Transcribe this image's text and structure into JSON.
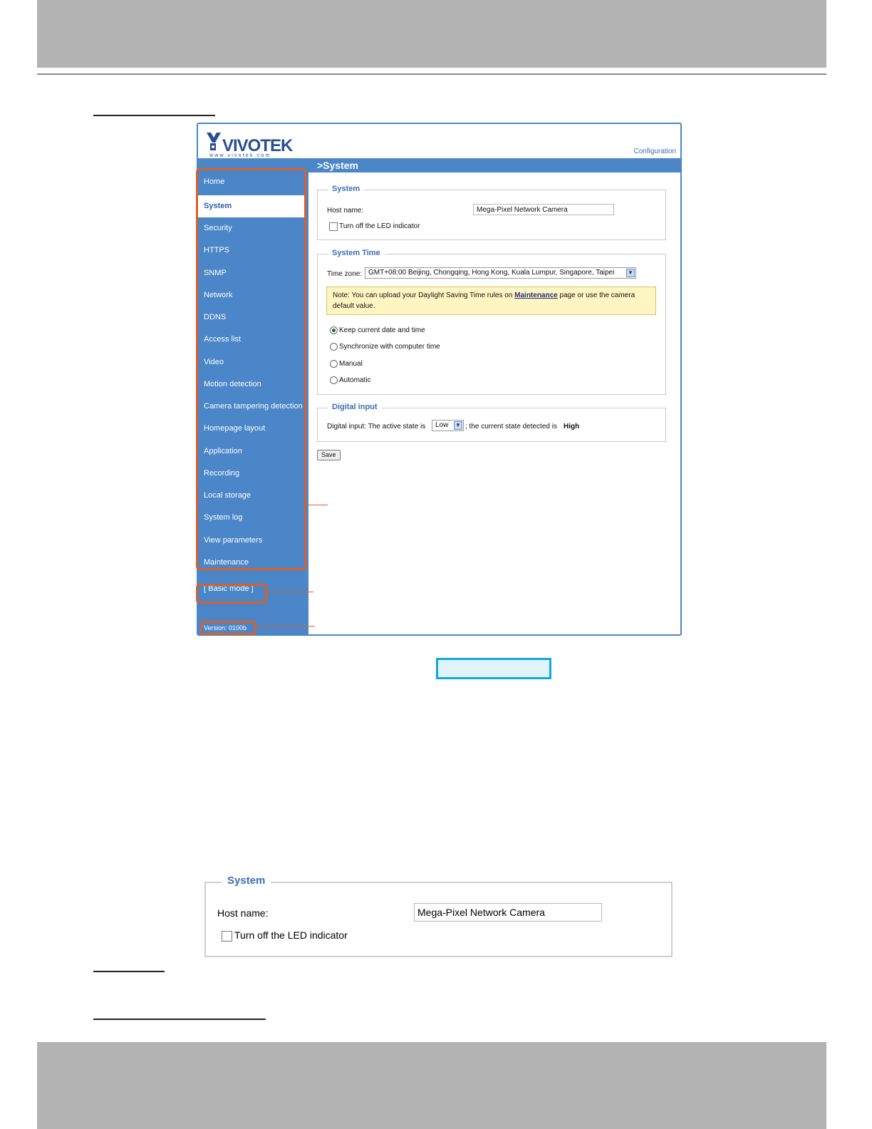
{
  "app": {
    "config_link": "Configuration",
    "page_title": ">System",
    "logo_text": "VIVOTEK",
    "logo_url_text": "www.vivotek.com"
  },
  "sidebar": {
    "items": [
      {
        "label": "Home"
      },
      {
        "label": "System"
      },
      {
        "label": "Security"
      },
      {
        "label": "HTTPS"
      },
      {
        "label": "SNMP"
      },
      {
        "label": "Network"
      },
      {
        "label": "DDNS"
      },
      {
        "label": "Access list"
      },
      {
        "label": "Video"
      },
      {
        "label": "Motion detection"
      },
      {
        "label": "Camera tampering detection"
      },
      {
        "label": "Homepage layout"
      },
      {
        "label": "Application"
      },
      {
        "label": "Recording"
      },
      {
        "label": "Local storage"
      },
      {
        "label": "System log"
      },
      {
        "label": "View parameters"
      },
      {
        "label": "Maintenance"
      }
    ],
    "active_item": "System",
    "mode_link": "[ Basic mode ]",
    "version": "Version: 0100b"
  },
  "system_section": {
    "legend": "System",
    "host_label": "Host name:",
    "host_value": "Mega-Pixel Network Camera",
    "led_label": "Turn off the LED indicator",
    "led_checked": false
  },
  "time_section": {
    "legend": "System Time",
    "tz_label": "Time zone:",
    "tz_value": "GMT+08:00 Beijing, Chongqing, Hong Kong, Kuala Lumpur, Singapore, Taipei",
    "note_before": "Note: You can upload your Daylight Saving Time rules on ",
    "note_link": "Maintenance",
    "note_after": " page or use the camera default value.",
    "options": [
      {
        "label": "Keep current date and time",
        "selected": true
      },
      {
        "label": "Synchronize with computer time",
        "selected": false
      },
      {
        "label": "Manual",
        "selected": false
      },
      {
        "label": "Automatic",
        "selected": false
      }
    ]
  },
  "digital_section": {
    "legend": "Digital input",
    "text_before": "Digital input: The active state is",
    "state_value": "Low",
    "text_after": "; the current state detected is",
    "detected_value": "High"
  },
  "save_label": "Save",
  "colors": {
    "sidebar": "#4a86c8",
    "highlight": "#d9602c",
    "legend": "#3a6fb5",
    "callout_box": "#12a7e2"
  }
}
